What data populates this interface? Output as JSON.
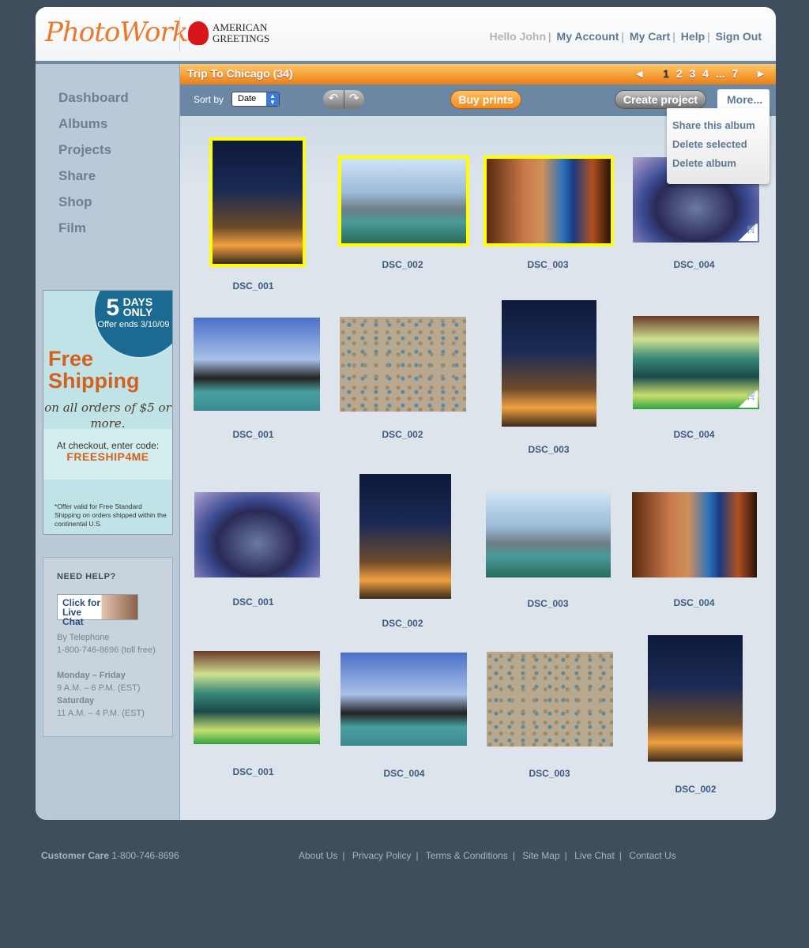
{
  "header": {
    "brand": "PhotoWorks",
    "brand_mark": "®",
    "partner": "AMERICAN GREETINGS",
    "greeting": "Hello John",
    "links": [
      "My Account",
      "My Cart",
      "Help",
      "Sign Out"
    ]
  },
  "sidebar": {
    "items": [
      "Dashboard",
      "Albums",
      "Projects",
      "Share",
      "Shop",
      "Film"
    ]
  },
  "promo": {
    "days": "5",
    "days_label": "DAYS ONLY",
    "offer_ends": "Offer ends 3/10/09",
    "headline1": "Free",
    "headline2": "Shipping",
    "sub": "on all orders of $5 or more.",
    "checkout": "At checkout, enter code:",
    "code": "FREESHIP4ME",
    "fine": "*Offer valid for Free Standard Shipping on orders shipped within the continental U.S."
  },
  "help": {
    "title": "NEED HELP?",
    "chat": "Click for Live Chat",
    "tel_label": "By Telephone",
    "phone": "1-800-746-8696 (toll free)",
    "weekday": "Monday – Friday",
    "weekday_hours": "9 A.M. – 6 P.M. (EST)",
    "saturday": "Saturday",
    "saturday_hours": "11 A.M. – 4 P.M. (EST)"
  },
  "album": {
    "title": "Trip To Chicago (34)",
    "pages": [
      "1",
      "2",
      "3",
      "4",
      "...",
      "7"
    ],
    "current_page": "1",
    "prev": "◄",
    "next": "►"
  },
  "toolbar": {
    "sort_label": "Sort by",
    "sort_value": "Date",
    "undo": "↶",
    "redo": "↷",
    "buy": "Buy prints",
    "create": "Create project",
    "more": "More..."
  },
  "more_menu": [
    "Share this album",
    "Delete selected",
    "Delete album"
  ],
  "photos": [
    "DSC_001",
    "DSC_002",
    "DSC_003",
    "DSC_004",
    "DSC_001",
    "DSC_002",
    "DSC_003",
    "DSC_004",
    "DSC_001",
    "DSC_002",
    "DSC_003",
    "DSC_004",
    "DSC_001",
    "DSC_004",
    "DSC_003",
    "DSC_002"
  ],
  "selected_photos": [
    0,
    1,
    2
  ],
  "cart_icon": "🛒",
  "footer": {
    "care_label": "Customer Care",
    "care_phone": "1-800-746-8696",
    "links": [
      "About Us",
      "Privacy Policy",
      "Terms & Conditions",
      "Site Map",
      "Live Chat",
      "Contact Us"
    ]
  }
}
